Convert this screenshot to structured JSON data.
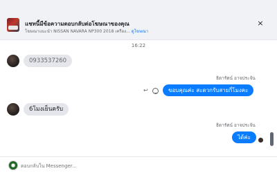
{
  "banner": {
    "title": "แชทนี้มีข้อความตอบกลับต่อโฆษณาของคุณ",
    "subtitle": "โฆษณาแนะนำ NISSAN NAVARA NP300 2018 เครือง... ",
    "subtitle_link": "ดูโฆษณา",
    "close_glyph": "×"
  },
  "chat": {
    "timestamp": "16:22",
    "messages": [
      {
        "direction": "in",
        "text": "0933537260"
      },
      {
        "direction": "out",
        "sender": "ธิดารัตน์ อาจประจัน",
        "text": "ขอบคุณค่ะ สะดวกรับสายกี่โมงคะ"
      },
      {
        "direction": "in",
        "text": "6โมงเย็นครับ"
      },
      {
        "direction": "out",
        "sender": "ธิดารัตน์ อาจประจัน",
        "text": "ได้ค่ะ"
      }
    ]
  },
  "composer": {
    "placeholder": "ตอบกลับใน Messenger..."
  },
  "colors": {
    "accent": "#0a7cff",
    "incoming_bubble": "#e4e6eb",
    "banner_bg": "#f0f2f5"
  },
  "icons": {
    "reply": "reply-icon",
    "reaction": "smiley-icon",
    "close": "close-icon"
  }
}
